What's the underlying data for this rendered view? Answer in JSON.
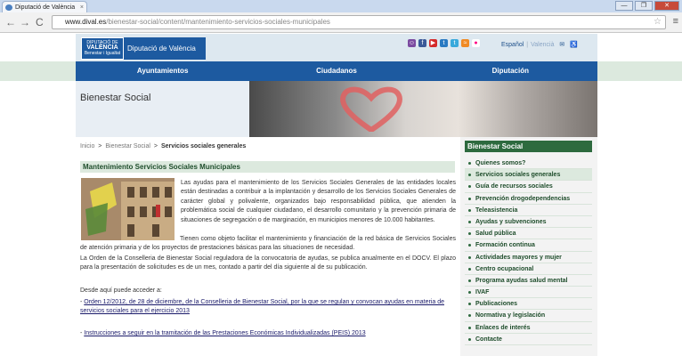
{
  "browser": {
    "tab_title": "Diputació de València",
    "tab_close": "×",
    "window_buttons": [
      "—",
      "❐",
      "✕"
    ],
    "url_domain": "www.dival.es",
    "url_path": "/bienestar-social/content/mantenimiento-servicios-sociales-municipales",
    "nav": [
      "←",
      "→",
      "C"
    ]
  },
  "header": {
    "logo_small": "DIPUTACIÓ DE",
    "logo_big": "VALÈNCIA",
    "logo_sub": "Benestar i Igualtat",
    "title": "Diputació de València",
    "social_icons": [
      "people-icon",
      "facebook-icon",
      "youtube-icon",
      "tuenti-icon",
      "twitter-icon",
      "rss-icon",
      "flickr-icon"
    ],
    "lang_es": "Español",
    "lang_va": "Valencià",
    "mail_icon": "✉",
    "access_icon": "♿"
  },
  "mainnav": [
    "Ayuntamientos",
    "Ciudadanos",
    "Diputación"
  ],
  "banner": {
    "title": "Bienestar Social"
  },
  "breadcrumb": {
    "home": "Inicio",
    "section": "Bienestar Social",
    "current": "Servicios sociales generales",
    "sep": ">"
  },
  "content": {
    "title": "Mantenimiento Servicios Sociales Municipales",
    "p1": "Las ayudas para el mantenimiento de los Servicios Sociales Generales de las entidades locales están destinadas a contribuir a la implantación y desarrollo de los Servicios Sociales Generales de carácter global y polivalente, organizados bajo responsabilidad pública, que atienden la problemática social de cualquier ciudadano, el desarrollo comunitario y la prevención primaria de situaciones de segregación o de marginación, en municipios menores de 10.000 habitantes.",
    "p2": "Tienen como objeto facilitar el mantenimiento y financiación de la red básica de Servicios Sociales de atención primaria y de los proyectos de prestaciones básicas para las situaciones de necesidad.",
    "p3": "La Orden de la Conselleria de Bienestar Social reguladora de la convocatoria de ayudas, se publica anualmente en el DOCV. El plazo para la presentación de solicitudes es de un mes, contado a partir del día siguiente al de su publicación.",
    "access_intro": "Desde aquí puede acceder a:",
    "link1": "Orden 12/2012, de 28 de diciembre, de la Conselleria de Bienestar Social, por la que se regulan y convocan ayudas en materia de servicios sociales para el ejercicio 2013",
    "link2": "Instrucciones a seguir en la tramitación de las Prestaciones Económicas Individualizadas (PEIS) 2013",
    "link_prefix": "- "
  },
  "sidebar": {
    "title": "Bienestar Social",
    "items": [
      {
        "label": "Quienes somos?"
      },
      {
        "label": "Servicios sociales generales"
      },
      {
        "label": "Guía de recursos sociales"
      },
      {
        "label": "Prevención drogodependencias"
      },
      {
        "label": "Teleasistencia"
      },
      {
        "label": "Ayudas y subvenciones"
      },
      {
        "label": "Salud pública"
      },
      {
        "label": "Formación continua"
      },
      {
        "label": "Actividades mayores y mujer"
      },
      {
        "label": "Centro ocupacional"
      },
      {
        "label": "Programa ayudas salud mental"
      },
      {
        "label": "IVAF"
      },
      {
        "label": "Publicaciones"
      },
      {
        "label": "Normativa y legislación"
      },
      {
        "label": "Enlaces de interés"
      },
      {
        "label": "Contacte"
      }
    ],
    "active_index": 1
  }
}
